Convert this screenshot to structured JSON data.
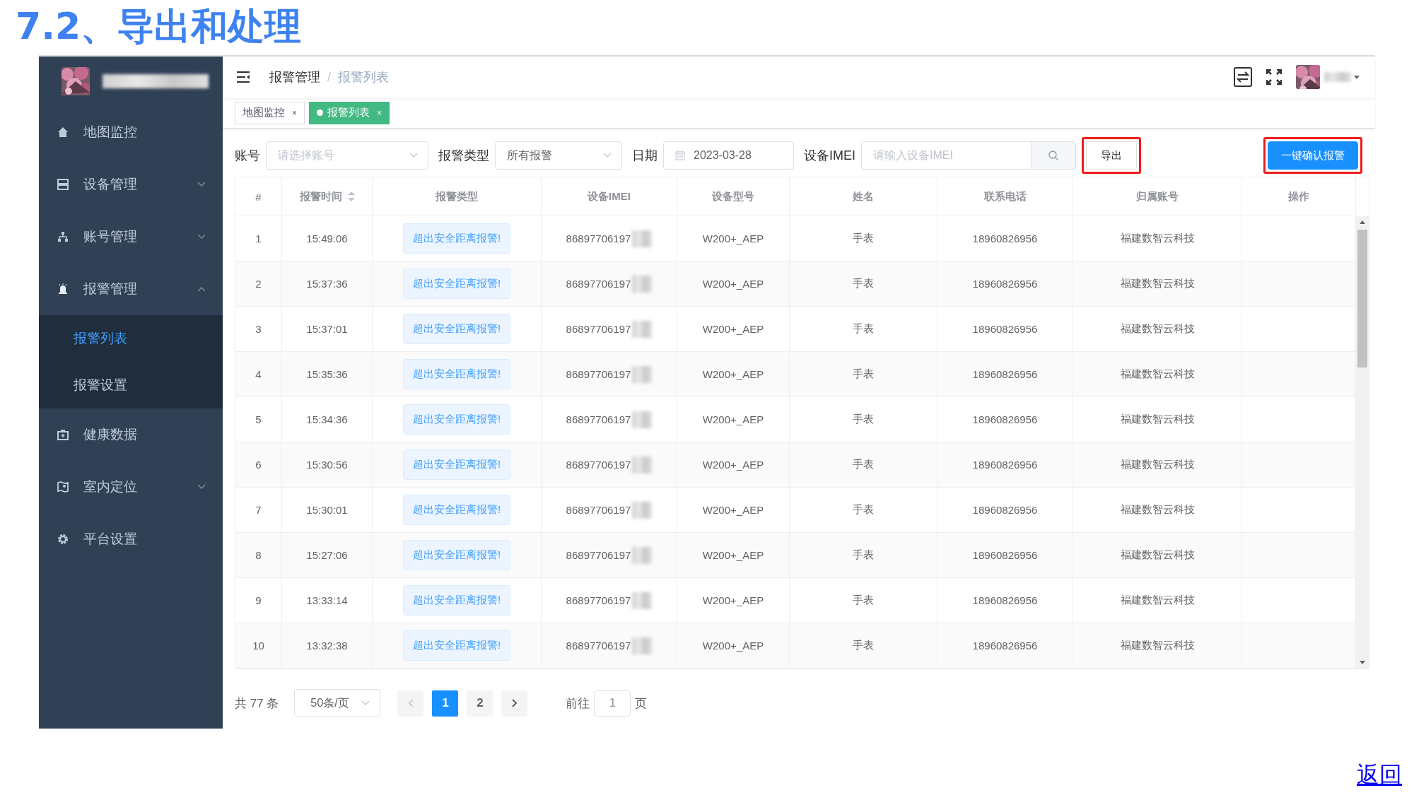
{
  "title": "7.2、导出和处理",
  "sidebar": {
    "items": [
      {
        "label": "地图监控",
        "selected": false
      },
      {
        "label": "设备管理",
        "selected": false,
        "expanded": false
      },
      {
        "label": "账号管理",
        "selected": false,
        "expanded": false
      },
      {
        "label": "报警管理",
        "selected": false,
        "expanded": true,
        "children": [
          {
            "label": "报警列表",
            "selected": true
          },
          {
            "label": "报警设置",
            "selected": false
          }
        ]
      },
      {
        "label": "健康数据",
        "selected": false
      },
      {
        "label": "室内定位",
        "selected": false,
        "expanded": false
      },
      {
        "label": "平台设置",
        "selected": false
      }
    ]
  },
  "breadcrumb": [
    "报警管理",
    "报警列表"
  ],
  "breadcrumb_separator": "/",
  "tabs": [
    {
      "label": "地图监控",
      "selected": false,
      "close": "×"
    },
    {
      "label": "报警列表",
      "selected": true,
      "close": "×"
    }
  ],
  "filters": {
    "account": {
      "label": "账号",
      "placeholder": "请选择账号"
    },
    "alarm_type": {
      "label": "报警类型",
      "value": "所有报警"
    },
    "date": {
      "label": "日期",
      "value": "2023-03-28"
    },
    "imei": {
      "label": "设备IMEI",
      "placeholder": "请输入设备IMEI"
    }
  },
  "buttons": [
    {
      "kind": "plain",
      "label": "导出",
      "highlighted": true
    },
    {
      "kind": "primary",
      "label": "一键确认报警",
      "highlighted": true
    }
  ],
  "table": {
    "columns": [
      {
        "label": "#"
      },
      {
        "label": "报警时间",
        "sortable": true
      },
      {
        "label": "报警类型"
      },
      {
        "label": "设备IMEI"
      },
      {
        "label": "设备型号"
      },
      {
        "label": "姓名"
      },
      {
        "label": "联系电话"
      },
      {
        "label": "归属账号"
      },
      {
        "label": "操作"
      }
    ],
    "rows": [
      [
        "1",
        "15:49:06",
        "超出安全距离报警!",
        "86897706197",
        "W200+_AEP",
        "手表",
        "18960826956",
        "福建数智云科技"
      ],
      [
        "2",
        "15:37:36",
        "超出安全距离报警!",
        "86897706197",
        "W200+_AEP",
        "手表",
        "18960826956",
        "福建数智云科技"
      ],
      [
        "3",
        "15:37:01",
        "超出安全距离报警!",
        "86897706197",
        "W200+_AEP",
        "手表",
        "18960826956",
        "福建数智云科技"
      ],
      [
        "4",
        "15:35:36",
        "超出安全距离报警!",
        "86897706197",
        "W200+_AEP",
        "手表",
        "18960826956",
        "福建数智云科技"
      ],
      [
        "5",
        "15:34:36",
        "超出安全距离报警!",
        "86897706197",
        "W200+_AEP",
        "手表",
        "18960826956",
        "福建数智云科技"
      ],
      [
        "6",
        "15:30:56",
        "超出安全距离报警!",
        "86897706197",
        "W200+_AEP",
        "手表",
        "18960826956",
        "福建数智云科技"
      ],
      [
        "7",
        "15:30:01",
        "超出安全距离报警!",
        "86897706197",
        "W200+_AEP",
        "手表",
        "18960826956",
        "福建数智云科技"
      ],
      [
        "8",
        "15:27:06",
        "超出安全距离报警!",
        "86897706197",
        "W200+_AEP",
        "手表",
        "18960826956",
        "福建数智云科技"
      ],
      [
        "9",
        "13:33:14",
        "超出安全距离报警!",
        "86897706197",
        "W200+_AEP",
        "手表",
        "18960826956",
        "福建数智云科技"
      ],
      [
        "10",
        "13:32:38",
        "超出安全距离报警!",
        "86897706197",
        "W200+_AEP",
        "手表",
        "18960826956",
        "福建数智云科技"
      ]
    ]
  },
  "pagination": {
    "total": "共 77 条",
    "page_size": "50条/页",
    "pages": [
      {
        "label": "1",
        "selected": true
      },
      {
        "label": "2",
        "selected": false
      }
    ],
    "goto_label": "前往",
    "goto_value": "1",
    "goto_suffix": "页"
  },
  "footer_link": "返回"
}
